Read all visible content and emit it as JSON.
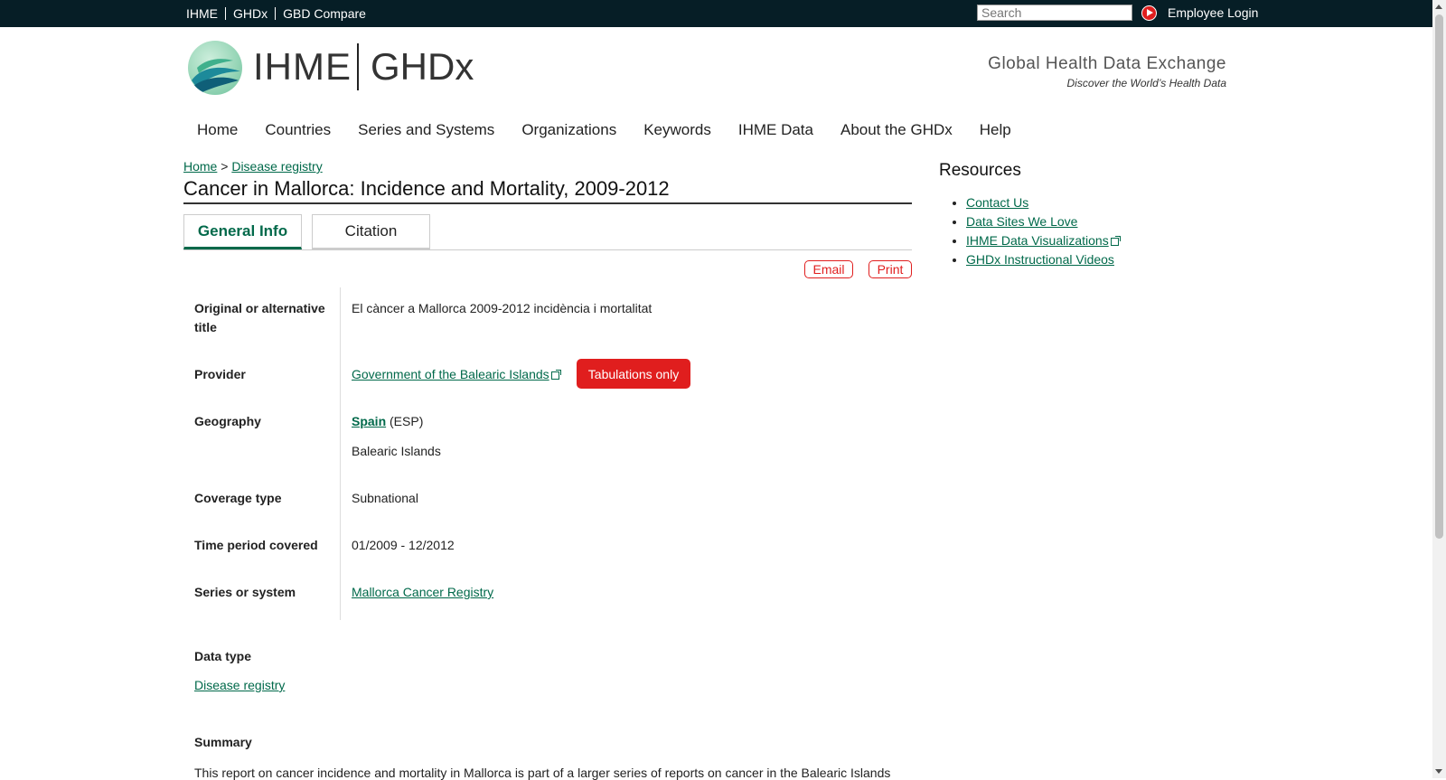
{
  "topbar": {
    "links": [
      "IHME",
      "GHDx",
      "GBD Compare"
    ],
    "search_placeholder": "Search",
    "employee_login": "Employee Login"
  },
  "header": {
    "brand_left": "IHME",
    "brand_right": "GHDx",
    "tagline": "Global Health Data Exchange",
    "subtagline": "Discover the World’s Health Data"
  },
  "nav": [
    "Home",
    "Countries",
    "Series and Systems",
    "Organizations",
    "Keywords",
    "IHME Data",
    "About the GHDx",
    "Help"
  ],
  "breadcrumb": {
    "home": "Home",
    "separator": ">",
    "current": "Disease registry"
  },
  "page_title": "Cancer in Mallorca: Incidence and Mortality, 2009-2012",
  "tabs": {
    "general": "General Info",
    "citation": "Citation"
  },
  "actions": {
    "email": "Email",
    "print": "Print"
  },
  "info": {
    "alt_title_label": "Original or alternative title",
    "alt_title_value": "El càncer a Mallorca 2009-2012 incidència i mortalitat",
    "provider_label": "Provider",
    "provider_value": "Government of the Balearic Islands",
    "provider_badge": "Tabulations only",
    "geography_label": "Geography",
    "geography_country": "Spain",
    "geography_code": "(ESP)",
    "geography_region": "Balearic Islands",
    "coverage_label": "Coverage type",
    "coverage_value": "Subnational",
    "time_label": "Time period covered",
    "time_value": "01/2009 - 12/2012",
    "series_label": "Series or system",
    "series_value": "Mallorca Cancer Registry",
    "data_type_label": "Data type",
    "data_type_value": "Disease registry",
    "summary_label": "Summary",
    "summary_text": "This report on cancer incidence and mortality in Mallorca is part of a larger series of reports on cancer in the Balearic Islands"
  },
  "resources": {
    "title": "Resources",
    "items": [
      "Contact Us",
      "Data Sites We Love",
      "IHME Data Visualizations",
      "GHDx Instructional Videos"
    ]
  },
  "colors": {
    "topbar_bg": "#061e26",
    "link_green": "#00694a",
    "accent_red": "#e01e1e"
  }
}
